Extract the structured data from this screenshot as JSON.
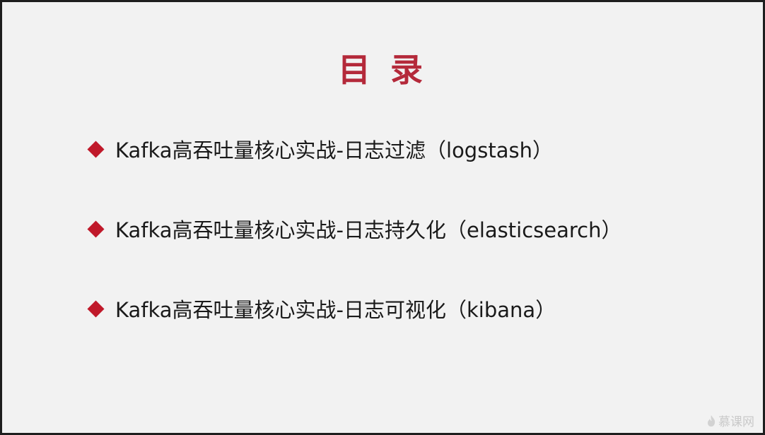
{
  "slide": {
    "title": "目 录",
    "items": [
      {
        "label": "Kafka高吞吐量核心实战-日志过滤（logstash）"
      },
      {
        "label": "Kafka高吞吐量核心实战-日志持久化（elasticsearch）"
      },
      {
        "label": "Kafka高吞吐量核心实战-日志可视化（kibana）"
      }
    ]
  },
  "watermark": {
    "brand": "慕课网",
    "icon": "flame-icon"
  },
  "colors": {
    "title": "#b4293a",
    "bullet": "#c0192a",
    "background": "#f2f2f2"
  }
}
